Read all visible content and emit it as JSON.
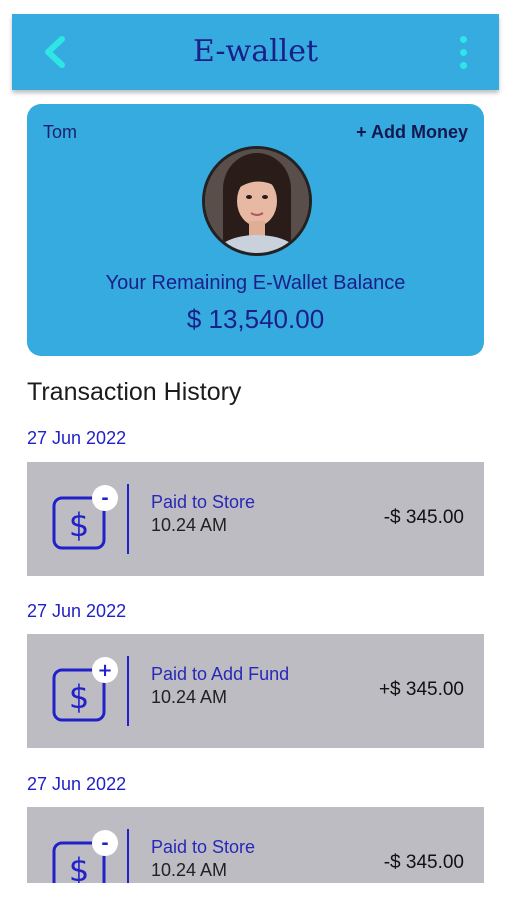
{
  "header": {
    "title": "E-wallet",
    "back_icon": "chevron-left-icon",
    "menu_icon": "more-vertical-icon"
  },
  "wallet": {
    "user_name": "Tom",
    "add_money_label": "+ Add Money",
    "balance_label": "Your Remaining E-Wallet Balance",
    "balance": "$ 13,540.00"
  },
  "history": {
    "title": "Transaction History",
    "items": [
      {
        "date": "27 Jun 2022",
        "description": "Paid to Store",
        "time": "10.24 AM",
        "amount": "-$ 345.00",
        "badge": "-"
      },
      {
        "date": "27 Jun 2022",
        "description": "Paid to Add Fund",
        "time": "10.24 AM",
        "amount": "+$ 345.00",
        "badge": "+"
      },
      {
        "date": "27 Jun 2022",
        "description": "Paid to Store",
        "time": "10.24 AM",
        "amount": "-$ 345.00",
        "badge": "-"
      }
    ]
  },
  "colors": {
    "primary": "#36abe0",
    "accent": "#2fe6e6",
    "text_dark_blue": "#1b1f88",
    "row_bg": "#bdbcc2"
  }
}
